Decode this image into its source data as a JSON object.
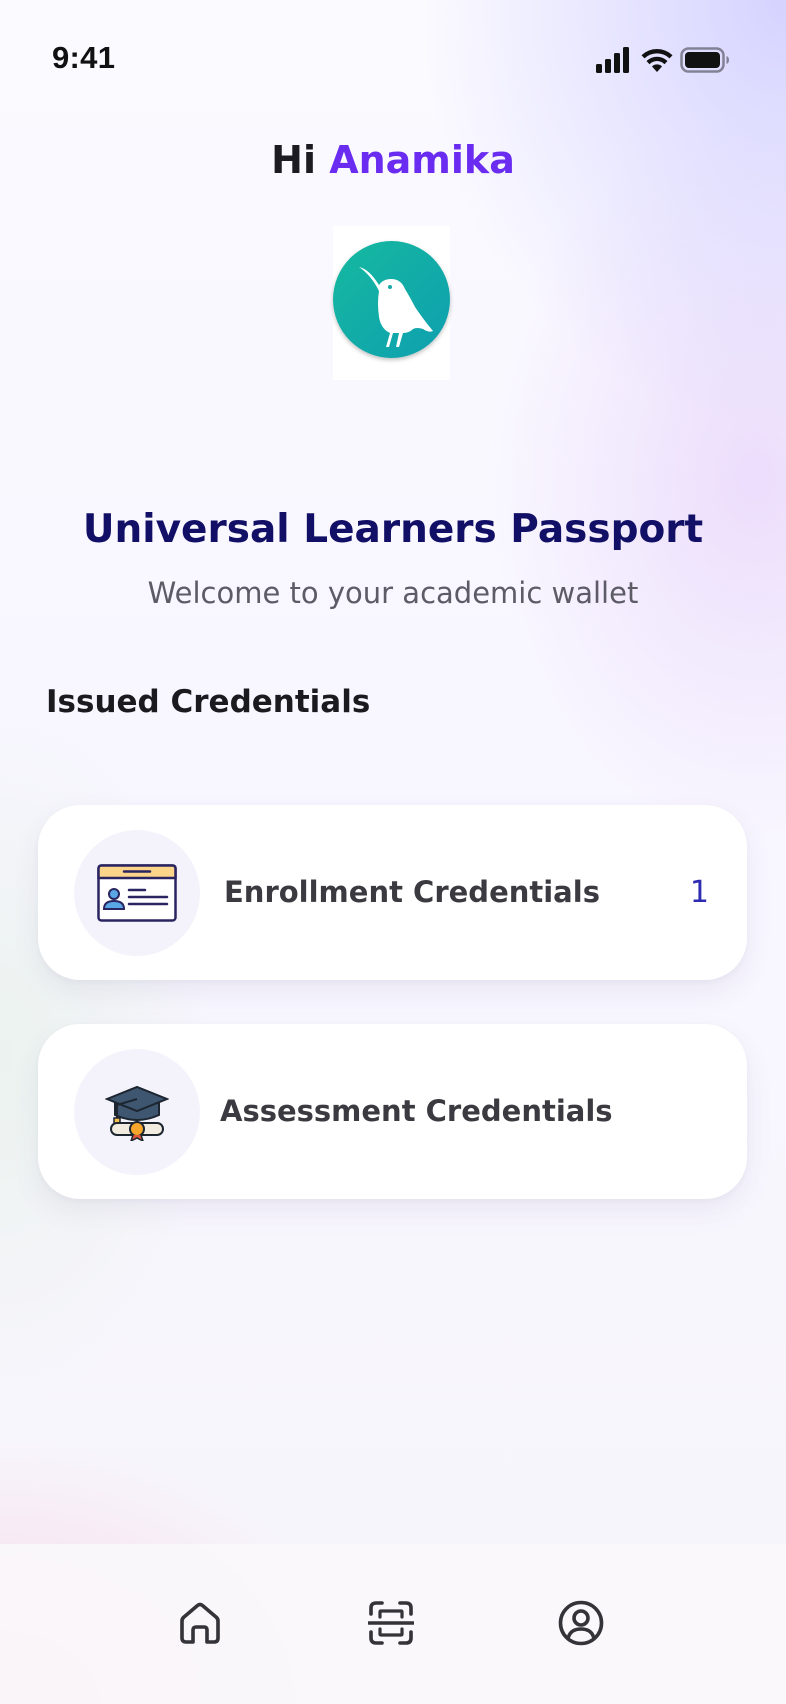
{
  "status_bar": {
    "time": "9:41",
    "icons": [
      "cellular-signal-icon",
      "wifi-icon",
      "battery-icon"
    ]
  },
  "greeting": {
    "prefix": "Hi",
    "user_name": "Anamika"
  },
  "logo": {
    "icon": "hummingbird-icon",
    "colors": {
      "start": "#16b99f",
      "end": "#0e9fb0"
    }
  },
  "header": {
    "title": "Universal Learners Passport",
    "subtitle": "Welcome to your academic wallet"
  },
  "issued_credentials": {
    "section_title": "Issued Credentials",
    "items": [
      {
        "label": "Enrollment Credentials",
        "count": "1",
        "icon": "id-card-icon"
      },
      {
        "label": "Assessment Credentials",
        "count": "",
        "icon": "graduation-cap-diploma-icon"
      }
    ]
  },
  "bottom_nav": {
    "items": [
      {
        "icon": "home-icon"
      },
      {
        "icon": "scan-icon"
      },
      {
        "icon": "profile-icon"
      }
    ]
  },
  "colors": {
    "accent": "#6a2cf0",
    "title": "#121066",
    "count": "#2e2bb3"
  }
}
